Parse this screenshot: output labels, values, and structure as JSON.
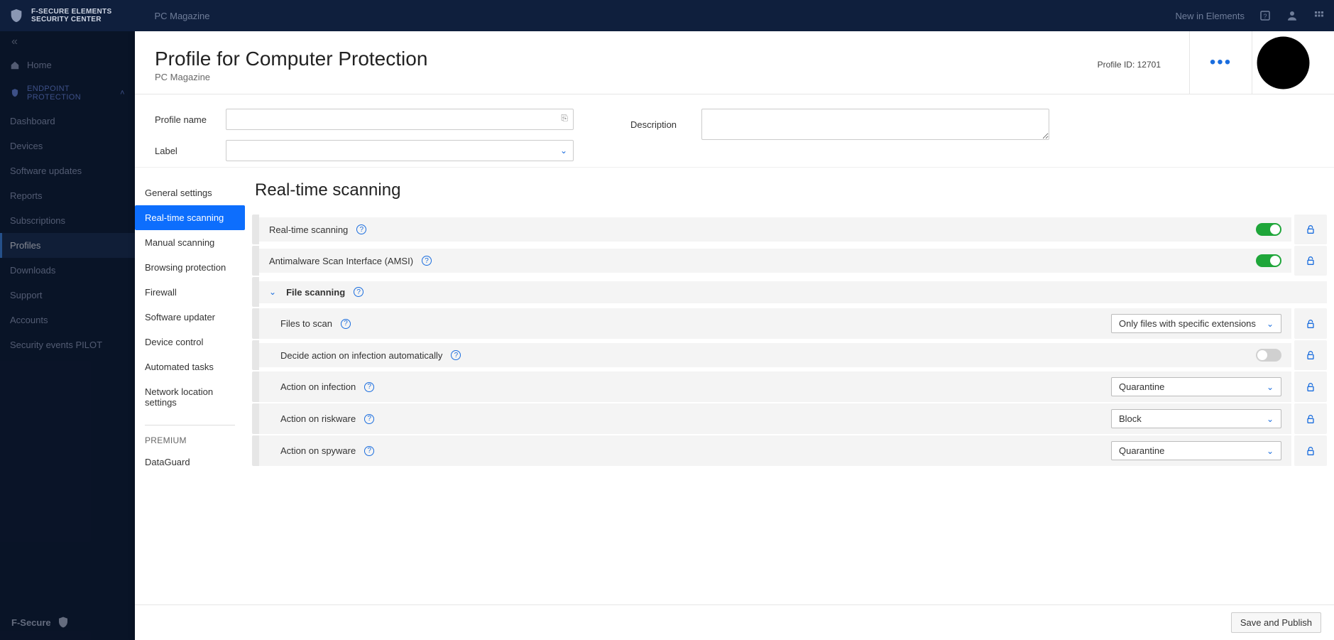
{
  "brand": {
    "line1": "F-SECURE ELEMENTS",
    "line2": "SECURITY CENTER",
    "footer": "F-Secure"
  },
  "topbar": {
    "breadcrumb": "PC Magazine",
    "new_link": "New in Elements"
  },
  "sidebar": {
    "home": "Home",
    "section": "ENDPOINT PROTECTION",
    "items": [
      "Dashboard",
      "Devices",
      "Software updates",
      "Reports",
      "Subscriptions",
      "Profiles",
      "Downloads",
      "Support",
      "Accounts",
      "Security events PILOT"
    ],
    "active_index": 5
  },
  "panel": {
    "title": "Profile for Computer Protection",
    "subtitle": "PC Magazine",
    "profile_id_label": "Profile ID:",
    "profile_id_value": "12701",
    "save_label": "Save and Publish"
  },
  "form": {
    "profile_name_label": "Profile name",
    "label_label": "Label",
    "description_label": "Description"
  },
  "tabs": {
    "items": [
      "General settings",
      "Real-time scanning",
      "Manual scanning",
      "Browsing protection",
      "Firewall",
      "Software updater",
      "Device control",
      "Automated tasks",
      "Network location settings"
    ],
    "active_index": 1,
    "premium_heading": "PREMIUM",
    "premium_items": [
      "DataGuard"
    ]
  },
  "settings": {
    "title": "Real-time scanning",
    "rows": [
      {
        "label": "Real-time scanning",
        "help": true,
        "control": "toggle",
        "value": "on"
      },
      {
        "label": "Antimalware Scan Interface (AMSI)",
        "help": true,
        "control": "toggle",
        "value": "on"
      },
      {
        "label": "File scanning",
        "help": true,
        "control": "group",
        "bold": true
      },
      {
        "label": "Files to scan",
        "help": true,
        "control": "select",
        "value": "Only files with specific extensions"
      },
      {
        "label": "Decide action on infection automatically",
        "help": true,
        "control": "toggle",
        "value": "off"
      },
      {
        "label": "Action on infection",
        "help": true,
        "control": "select",
        "value": "Quarantine"
      },
      {
        "label": "Action on riskware",
        "help": true,
        "control": "select",
        "value": "Block"
      },
      {
        "label": "Action on spyware",
        "help": true,
        "control": "select",
        "value": "Quarantine"
      }
    ]
  }
}
